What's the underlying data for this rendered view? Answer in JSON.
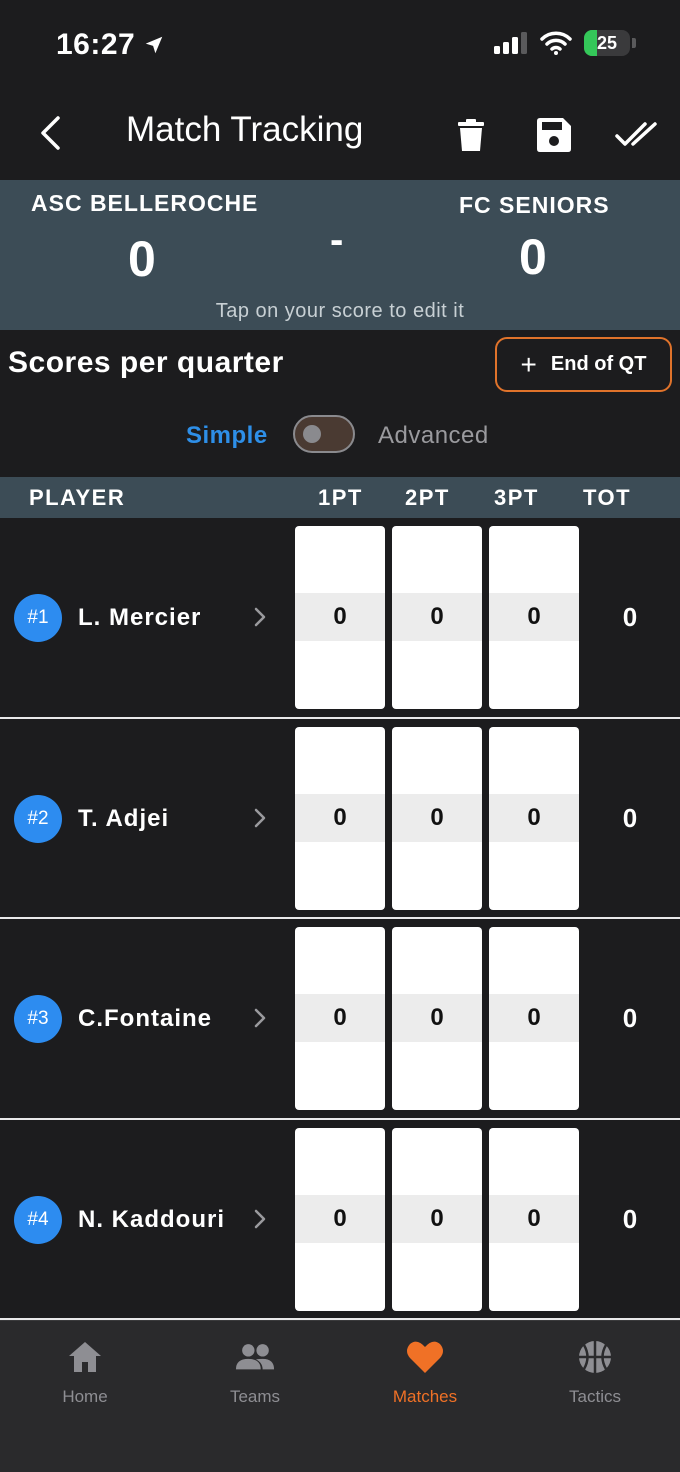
{
  "status_bar": {
    "time": "16:27",
    "battery": "25"
  },
  "header": {
    "title": "Match Tracking"
  },
  "scoreboard": {
    "home_team": "ASC BELLEROCHE",
    "home_score": "0",
    "away_team": "FC SENIORS",
    "away_score": "0",
    "separator": "-",
    "hint": "Tap on your score to edit it"
  },
  "quarters": {
    "title": "Scores per quarter",
    "end_button": "End of QT",
    "end_button_plus": "+",
    "mode_simple": "Simple",
    "mode_advanced": "Advanced"
  },
  "table": {
    "headers": {
      "player": "PLAYER",
      "pt1": "1PT",
      "pt2": "2PT",
      "pt3": "3PT",
      "tot": "TOT"
    },
    "rows": [
      {
        "number": "#1",
        "name": "L. Mercier",
        "pt1": "0",
        "pt2": "0",
        "pt3": "0",
        "tot": "0"
      },
      {
        "number": "#2",
        "name": "T. Adjei",
        "pt1": "0",
        "pt2": "0",
        "pt3": "0",
        "tot": "0"
      },
      {
        "number": "#3",
        "name": "C.Fontaine",
        "pt1": "0",
        "pt2": "0",
        "pt3": "0",
        "tot": "0"
      },
      {
        "number": "#4",
        "name": "N. Kaddouri",
        "pt1": "0",
        "pt2": "0",
        "pt3": "0",
        "tot": "0"
      }
    ]
  },
  "nav": {
    "home": "Home",
    "teams": "Teams",
    "matches": "Matches",
    "tactics": "Tactics"
  },
  "colors": {
    "accent_orange": "#f07126",
    "accent_blue": "#2e8fe8",
    "panel": "#3c4c56",
    "background": "#1c1c1e"
  }
}
